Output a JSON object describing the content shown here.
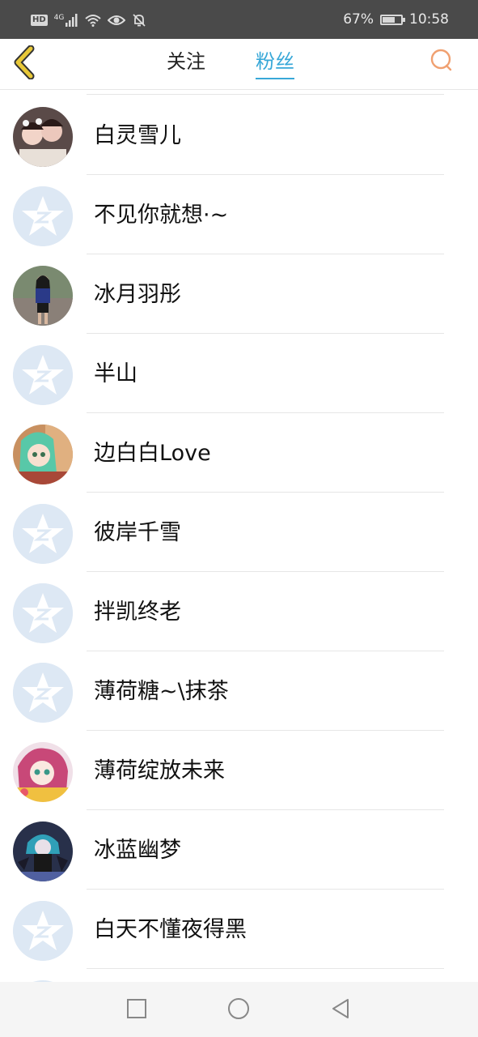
{
  "status_bar": {
    "hd": "HD",
    "network": "4G",
    "battery_percent": "67%",
    "battery_level": 0.67,
    "time": "10:58"
  },
  "header": {
    "back_icon": "chevron-left-icon",
    "tabs": [
      {
        "label": "关注",
        "active": false
      },
      {
        "label": "粉丝",
        "active": true
      }
    ],
    "search_icon": "search-icon",
    "accent_color": "#38a8d8",
    "back_color": "#e8c838"
  },
  "fans": [
    {
      "name": "白灵雪儿",
      "avatar": "photo"
    },
    {
      "name": "不见你就想·~",
      "avatar": "default"
    },
    {
      "name": "冰月羽彤",
      "avatar": "photo"
    },
    {
      "name": "半山",
      "avatar": "default"
    },
    {
      "name": "边白白Love",
      "avatar": "photo"
    },
    {
      "name": "彼岸千雪",
      "avatar": "default"
    },
    {
      "name": "拌凯终老",
      "avatar": "default"
    },
    {
      "name": "薄荷糖~\\抹茶",
      "avatar": "default"
    },
    {
      "name": "薄荷绽放未来",
      "avatar": "photo"
    },
    {
      "name": "冰蓝幽梦",
      "avatar": "photo"
    },
    {
      "name": "白天不懂夜得黑",
      "avatar": "default"
    }
  ],
  "nav_bar": {
    "buttons": [
      "recents-square-icon",
      "home-circle-icon",
      "back-triangle-icon"
    ]
  }
}
